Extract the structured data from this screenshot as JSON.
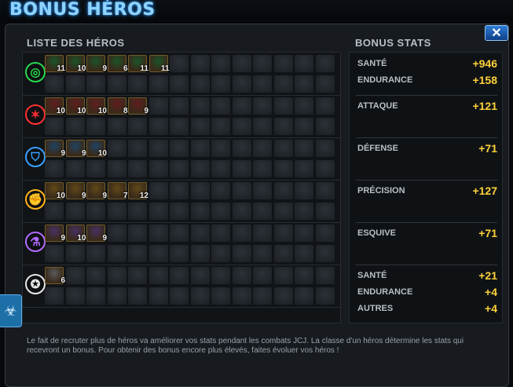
{
  "window": {
    "title": "BONUS HÉROS",
    "close_label": "✕"
  },
  "list_header": "LISTE DES HÉROS",
  "stats_header": "BONUS STATS",
  "hero_classes": [
    {
      "icon": "cosmic-class-icon",
      "glyph": "◎",
      "color": "#29d84a",
      "owned_levels": [
        "11",
        "10",
        "9",
        "6",
        "11",
        "11"
      ]
    },
    {
      "icon": "mutant-class-icon",
      "glyph": "✶",
      "color": "#ff3030",
      "owned_levels": [
        "10",
        "10",
        "10",
        "8",
        "9"
      ]
    },
    {
      "icon": "tech-class-icon",
      "glyph": "⛉",
      "color": "#3aa0ff",
      "owned_levels": [
        "9",
        "9",
        "10"
      ]
    },
    {
      "icon": "skill-class-icon",
      "glyph": "✊",
      "color": "#ffb31a",
      "owned_levels": [
        "10",
        "9",
        "9",
        "7",
        "12"
      ]
    },
    {
      "icon": "science-class-icon",
      "glyph": "⚗",
      "color": "#b26bff",
      "owned_levels": [
        "9",
        "10",
        "9"
      ]
    },
    {
      "icon": "universal-class-icon",
      "glyph": "✪",
      "color": "#e8e8e8",
      "owned_levels": [
        "6"
      ]
    }
  ],
  "bonus_stats": [
    {
      "rows": [
        {
          "label": "SANTÉ",
          "value": "+946"
        },
        {
          "label": "ENDURANCE",
          "value": "+158"
        }
      ]
    },
    {
      "rows": [
        {
          "label": "ATTAQUE",
          "value": "+121"
        }
      ]
    },
    {
      "rows": [
        {
          "label": "DÉFENSE",
          "value": "+71"
        }
      ]
    },
    {
      "rows": [
        {
          "label": "PRÉCISION",
          "value": "+127"
        }
      ]
    },
    {
      "rows": [
        {
          "label": "ESQUIVE",
          "value": "+71"
        }
      ]
    },
    {
      "rows": [
        {
          "label": "SANTÉ",
          "value": "+21"
        },
        {
          "label": "ENDURANCE",
          "value": "+4"
        },
        {
          "label": "AUTRES",
          "value": "+4"
        }
      ]
    }
  ],
  "footer_text": "Le fait de recruter plus de héros va améliorer vos stats pendant les combats JCJ. La classe d'un héros détermine les stats qui recevront un bonus. Pour obtenir des bonus encore plus élevés, faites évoluer vos héros !",
  "side_icon": "biohazard-icon",
  "colors": {
    "accent": "#1c79d8",
    "stat_value": "#ffd23a"
  }
}
